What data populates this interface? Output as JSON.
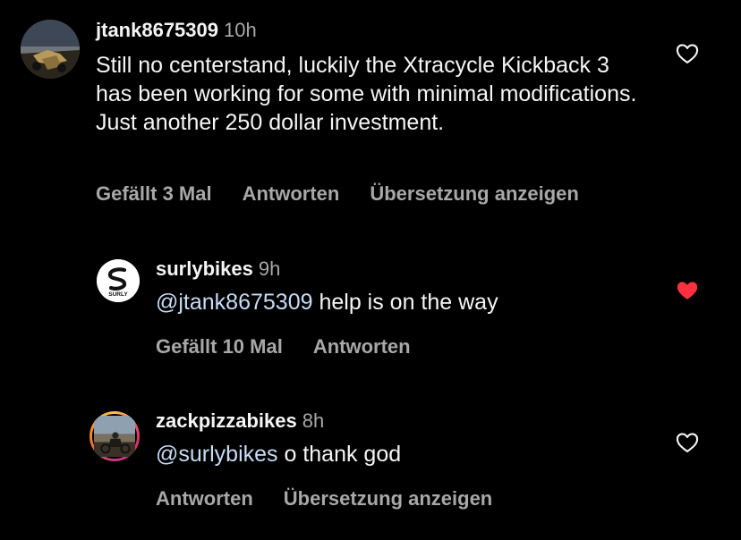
{
  "comments": [
    {
      "username": "jtank8675309",
      "time": "10h",
      "mention": "",
      "text": "Still no centerstand, luckily the Xtracycle Kickback 3 has been working for some with minimal modifications. Just another 250 dollar investment.",
      "likes_label": "Gefällt 3 Mal",
      "reply_label": "Antworten",
      "translate_label": "Übersetzung anzeigen",
      "liked": false
    },
    {
      "username": "surlybikes",
      "time": "9h",
      "mention": "@jtank8675309",
      "text": "help is on the way",
      "likes_label": "Gefällt 10 Mal",
      "reply_label": "Antworten",
      "liked": true,
      "avatar_text": "SURLY"
    },
    {
      "username": "zackpizzabikes",
      "time": "8h",
      "mention": "@surlybikes",
      "text": "o thank god",
      "reply_label": "Antworten",
      "translate_label": "Übersetzung anzeigen",
      "liked": false
    }
  ],
  "icons": {
    "like_empty": "heart-outline-icon",
    "like_filled": "heart-filled-icon"
  },
  "colors": {
    "background": "#000000",
    "text": "#f5f5f5",
    "muted": "#a8a8a8",
    "mention": "#c7dcf5",
    "liked_heart": "#ff3040"
  }
}
